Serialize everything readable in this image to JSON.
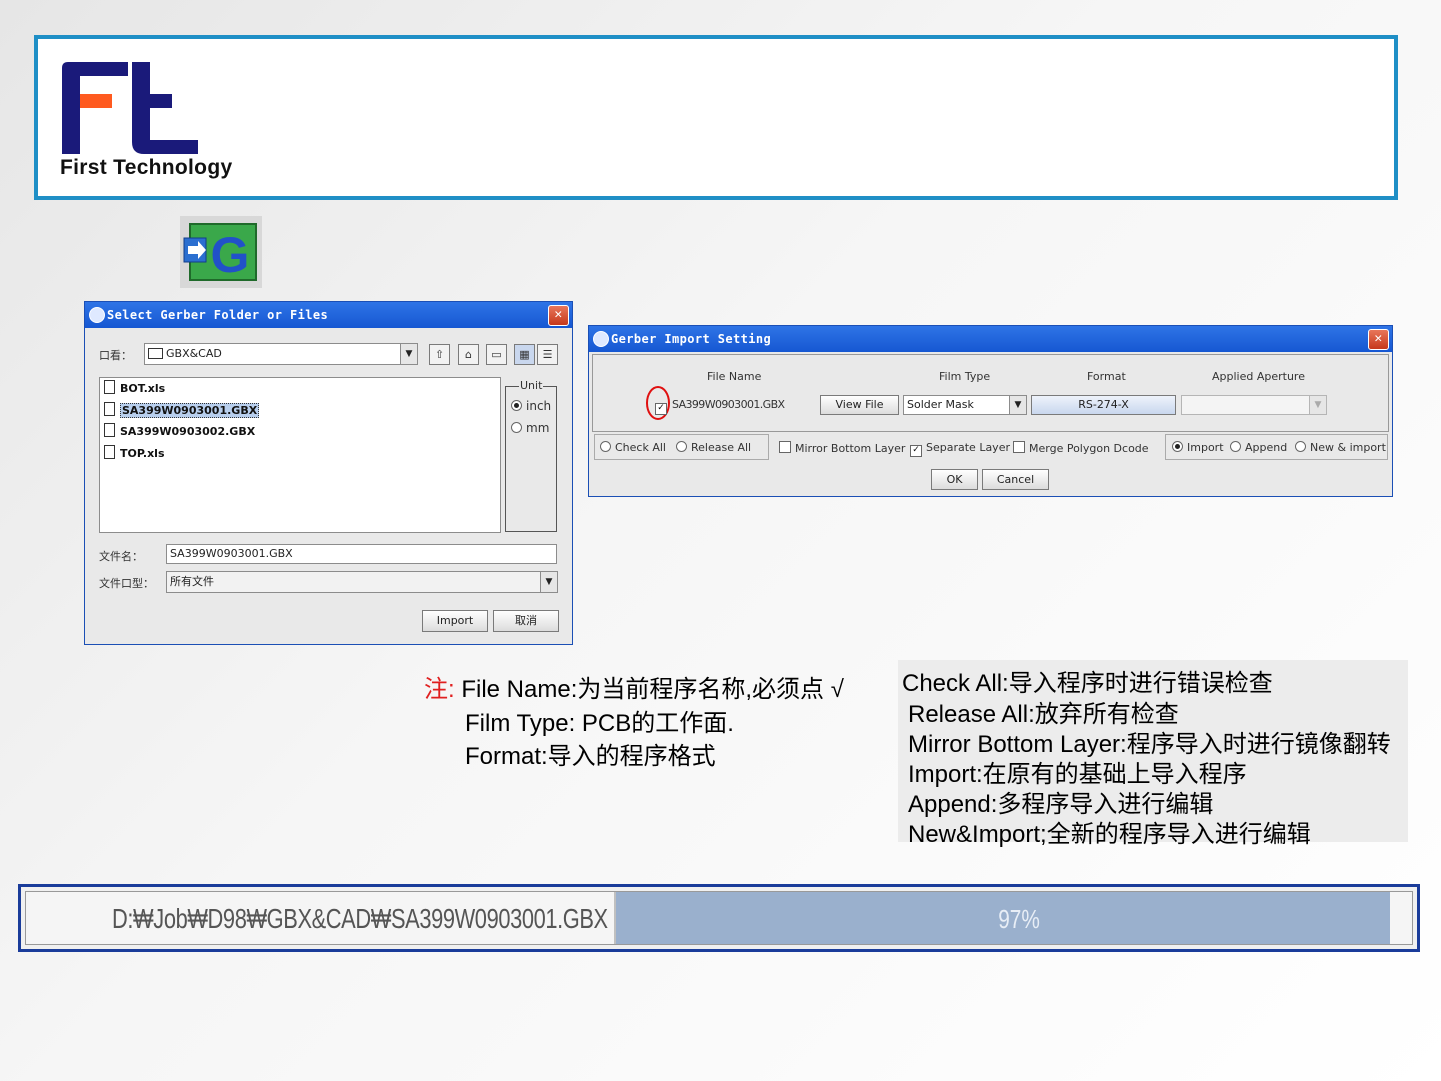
{
  "brand": {
    "company": "First Technology"
  },
  "select_dialog": {
    "title": "Select Gerber Folder or Files",
    "look_in_label": "口看：",
    "look_in_value": "GBX&CAD",
    "files": [
      "BOT.xls",
      "SA399W0903001.GBX",
      "SA399W0903002.GBX",
      "TOP.xls"
    ],
    "unit_label": "Unit",
    "unit_options": [
      "inch",
      "mm"
    ],
    "filename_label": "文件名：",
    "filename_value": "SA399W0903001.GBX",
    "filetype_label": "文件口型：",
    "filetype_value": "所有文件",
    "import_button": "Import",
    "cancel_button": "取消"
  },
  "import_dialog": {
    "title": "Gerber Import Setting",
    "headers": [
      "File Name",
      "Film Type",
      "Format",
      "Applied Aperture"
    ],
    "row": {
      "checked": true,
      "file_name": "SA399W0903001.GBX",
      "view_button": "View File",
      "film_type": "Solder Mask",
      "format": "RS-274-X",
      "aperture": ""
    },
    "options": {
      "check_all": "Check All",
      "release_all": "Release All",
      "mirror_bottom": "Mirror Bottom Layer",
      "separate_layer": "Separate Layer",
      "merge_polygon": "Merge Polygon Dcode",
      "import": "Import",
      "append": "Append",
      "new_import": "New & import"
    },
    "ok_button": "OK",
    "cancel_button": "Cancel"
  },
  "notes_left": {
    "prefix": "注:",
    "line1": " File Name:为当前程序名称,必须点 √",
    "line2": "Film Type: PCB的工作面.",
    "line3": "Format:导入的程序格式"
  },
  "notes_right": [
    "Check All:导入程序时进行错误检查",
    "Release All:放弃所有检查",
    "Mirror Bottom Layer:程序导入时进行镜像翻转",
    "Import:在原有的基础上导入程序",
    "Append:多程序导入进行编辑",
    "New&Import;全新的程序导入进行编辑"
  ],
  "progress": {
    "path": "D:₩Job₩D98₩GBX&CAD₩SA399W0903001.GBX",
    "percent_label": "97%",
    "fraction": 0.97
  },
  "colors": {
    "banner_border": "#1f8fc6",
    "logo_blue": "#1a1a7a",
    "logo_orange": "#ff5a1f",
    "titlebar": "#1657d2"
  }
}
